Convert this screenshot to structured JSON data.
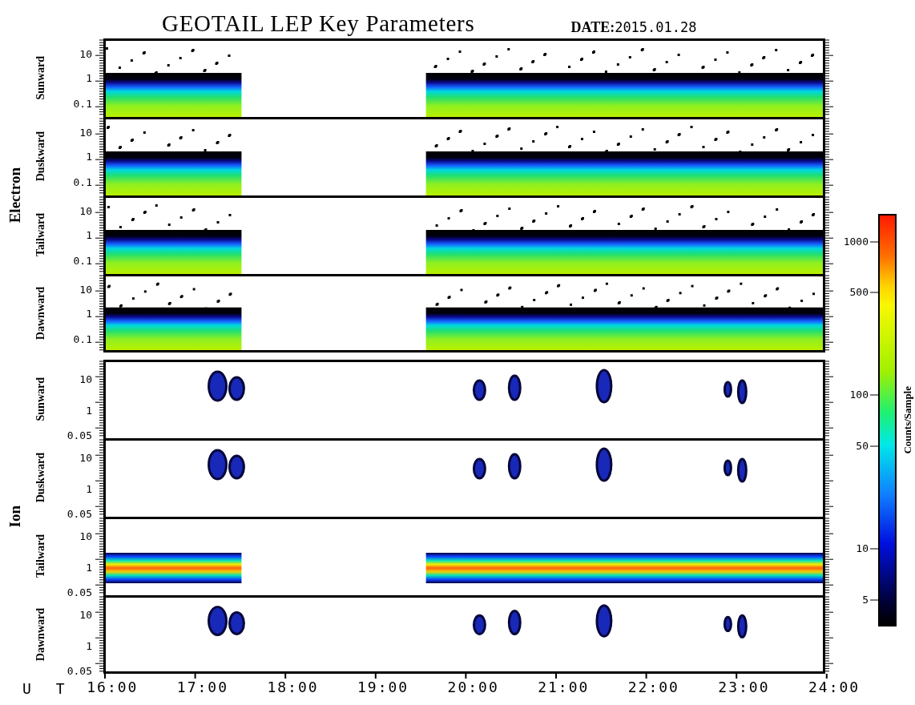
{
  "title": "GEOTAIL LEP Key Parameters",
  "date": {
    "label": "DATE:",
    "value": "2015.01.28"
  },
  "groups": [
    {
      "name": "Electron",
      "panels": [
        {
          "name": "Sunward",
          "kind": "electron",
          "yticks": [
            "10",
            "1",
            "0.1"
          ]
        },
        {
          "name": "Duskward",
          "kind": "electron",
          "yticks": [
            "10",
            "1",
            "0.1"
          ]
        },
        {
          "name": "Tailward",
          "kind": "electron",
          "yticks": [
            "10",
            "1",
            "0.1"
          ]
        },
        {
          "name": "Dawnward",
          "kind": "electron",
          "yticks": [
            "10",
            "1",
            "0.1"
          ]
        }
      ]
    },
    {
      "name": "Ion",
      "panels": [
        {
          "name": "Sunward",
          "kind": "blobs",
          "yticks": [
            "10",
            "1",
            "0.05"
          ]
        },
        {
          "name": "Duskward",
          "kind": "blobs",
          "yticks": [
            "10",
            "1",
            "0.05"
          ]
        },
        {
          "name": "Tailward",
          "kind": "band",
          "yticks": [
            "10",
            "1",
            "0.05"
          ]
        },
        {
          "name": "Dawnward",
          "kind": "blobs",
          "yticks": [
            "10",
            "1",
            "0.05"
          ]
        }
      ]
    }
  ],
  "x_axis": {
    "label": "U T",
    "ticks": [
      "16:00",
      "17:00",
      "18:00",
      "19:00",
      "20:00",
      "21:00",
      "22:00",
      "23:00",
      "24:00"
    ]
  },
  "colorbar": {
    "label": "Counts/Sample",
    "ticks": [
      "1000",
      "500",
      "100",
      "50",
      "10",
      "5"
    ]
  }
}
